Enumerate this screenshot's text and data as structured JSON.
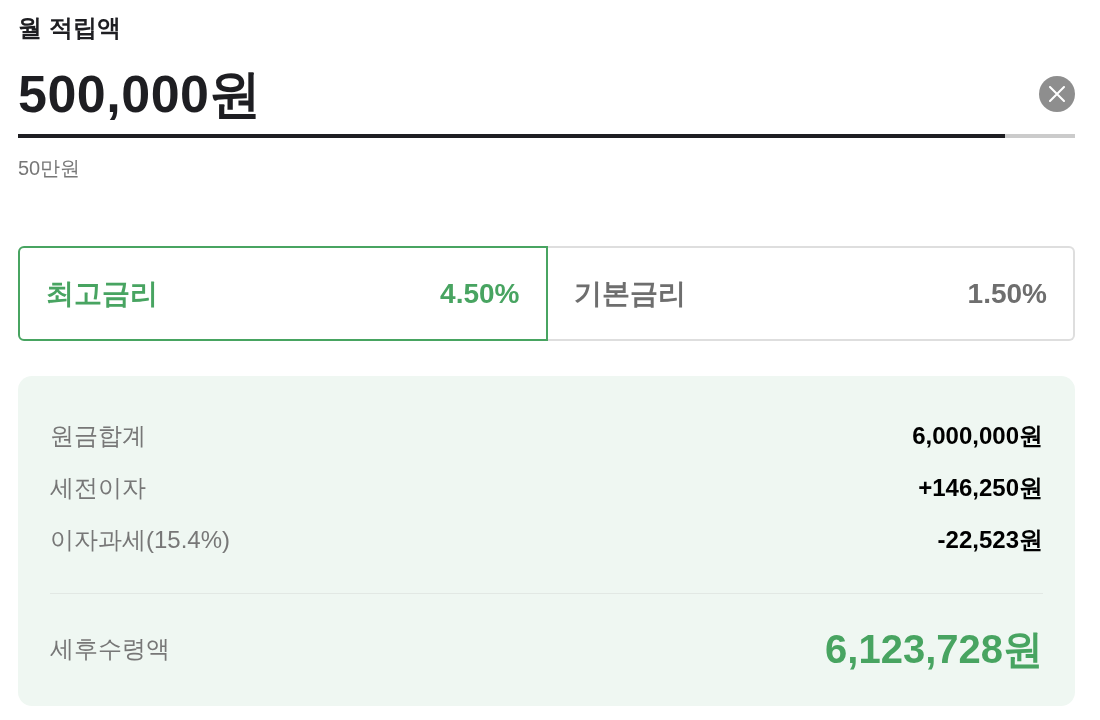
{
  "field": {
    "label": "월 적립액",
    "value": "500,000원",
    "hint": "50만원",
    "underline": {
      "level": 0.934
    }
  },
  "rates": [
    {
      "label": "최고금리",
      "value": "4.50%",
      "selected": true
    },
    {
      "label": "기본금리",
      "value": "1.50%",
      "selected": false
    }
  ],
  "summary": {
    "rows": [
      {
        "label": "원금합계",
        "value": "6,000,000원"
      },
      {
        "label": "세전이자",
        "value": "+146,250원"
      },
      {
        "label": "이자과세(15.4%)",
        "value": "-22,523원"
      }
    ],
    "total": {
      "label": "세후수령액",
      "value": "6,123,728원"
    }
  }
}
